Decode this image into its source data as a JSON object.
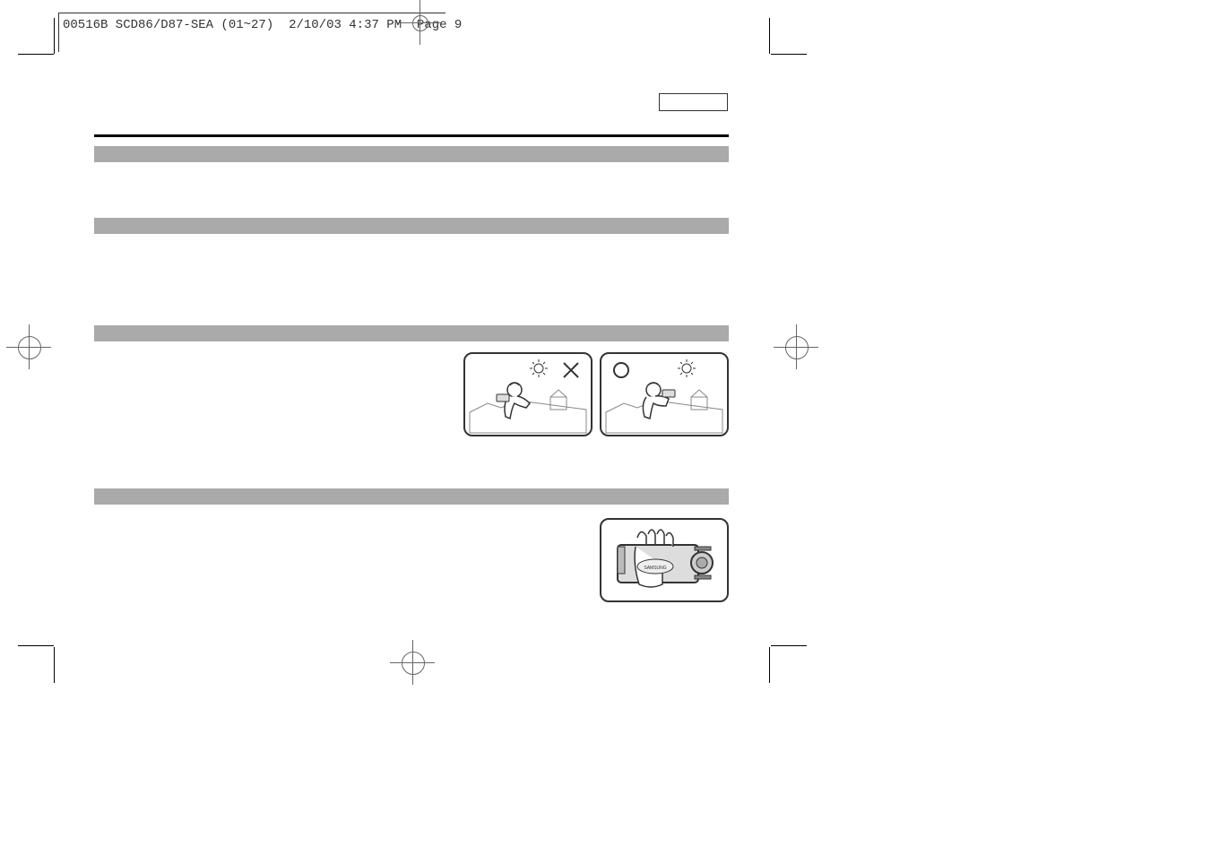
{
  "header": {
    "doc_id": "00516B SCD86/D87-SEA (01~27)",
    "date": "2/10/03",
    "time": "4:37 PM",
    "page_label": "Page",
    "page_num": "9"
  },
  "illustrations": {
    "wrong_marker": "✕",
    "correct_marker": "○"
  }
}
